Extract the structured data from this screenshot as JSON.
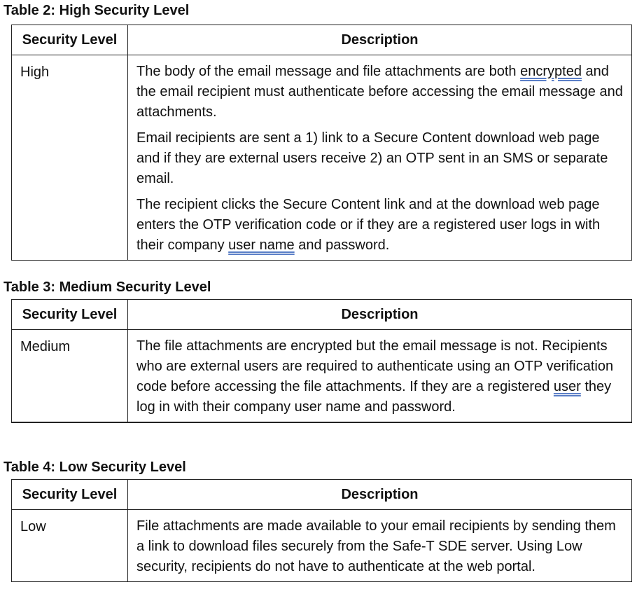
{
  "tables": [
    {
      "caption": "Table 2: High Security Level",
      "header_level": "Security Level",
      "header_desc": "Description",
      "level": "High",
      "paragraphs": [
        [
          "The body of the email message and file attachments are both ",
          "encrypted",
          " and the email recipient must authenticate before accessing the email message and attachments."
        ],
        [
          "Email recipients are sent a 1) link to a Secure Content download web page and if they are external users receive 2) an OTP sent in an SMS or separate email."
        ],
        [
          "The recipient clicks the Secure Content link and at the download web page enters the OTP verification code or if they are a registered user logs in with their company ",
          "user name",
          " and password."
        ]
      ]
    },
    {
      "caption": "Table 3: Medium Security Level",
      "header_level": "Security Level",
      "header_desc": "Description",
      "level": "Medium",
      "paragraphs": [
        [
          "The file attachments are encrypted but the email message is not. Recipients who are external users are required to authenticate using an OTP verification code before accessing the file attachments. If they are a registered ",
          "user",
          " they log in with their company user name and password."
        ]
      ]
    },
    {
      "caption": "Table 4: Low Security Level",
      "header_level": "Security Level",
      "header_desc": "Description",
      "level": "Low",
      "paragraphs": [
        [
          "File attachments are made available to your email recipients by sending them a link to download files securely from the Safe-T SDE server. Using Low security, recipients do not have to authenticate at the web portal."
        ]
      ]
    }
  ]
}
